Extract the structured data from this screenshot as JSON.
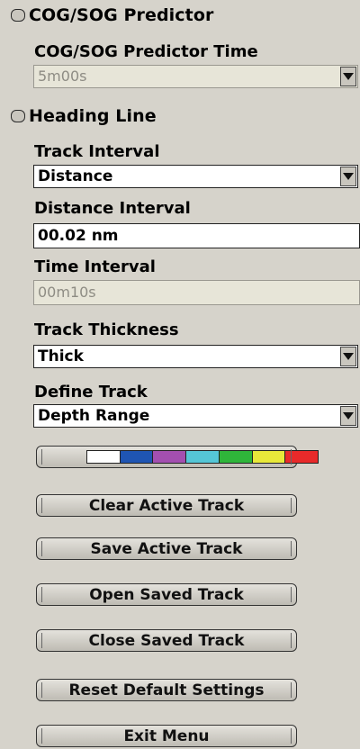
{
  "cog_sog": {
    "label": "COG/SOG Predictor",
    "checked": false
  },
  "predictor_time": {
    "label": "COG/SOG Predictor Time",
    "value": "5m00s",
    "enabled": false
  },
  "heading_line": {
    "label": "Heading Line",
    "checked": false
  },
  "track_interval": {
    "label": "Track Interval",
    "value": "Distance"
  },
  "distance_interval": {
    "label": "Distance Interval",
    "value": "00.02 nm"
  },
  "time_interval": {
    "label": "Time Interval",
    "value": "00m10s",
    "enabled": false
  },
  "track_thickness": {
    "label": "Track Thickness",
    "value": "Thick"
  },
  "define_track": {
    "label": "Define Track",
    "value": "Depth Range"
  },
  "depth_colors": [
    "#ffffff",
    "#1f55b3",
    "#a34fb0",
    "#55c6d6",
    "#2fb53a",
    "#e8e83a",
    "#e82a2a"
  ],
  "buttons": {
    "clear_active": "Clear Active Track",
    "save_active": "Save Active Track",
    "open_saved": "Open Saved Track",
    "close_saved": "Close Saved Track",
    "reset_defaults": "Reset Default Settings",
    "exit_menu": "Exit Menu"
  }
}
